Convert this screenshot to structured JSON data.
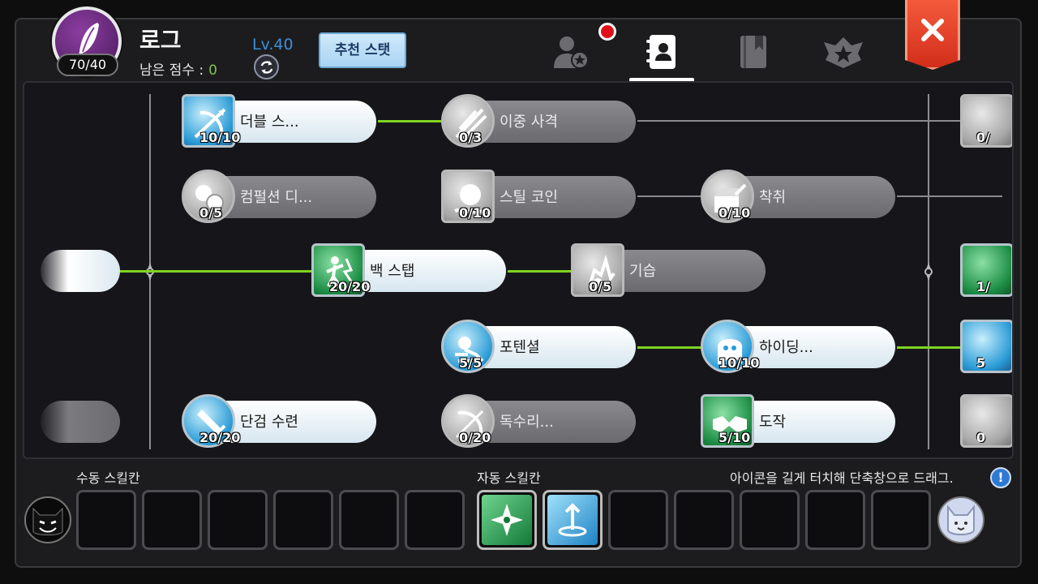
{
  "header": {
    "class_name": "로그",
    "ability_points": "70/40",
    "remaining_label": "남은 점수 :",
    "remaining_value": "0",
    "level": "Lv.40",
    "recommend_button": "추천 스탯",
    "tabs": [
      "character-tab",
      "skill-book-tab",
      "codex-tab",
      "rank-tab"
    ],
    "active_tab": "skill-book-tab",
    "accent_color": "#7ed321"
  },
  "tree": {
    "left_partials": [
      {
        "state": "learned"
      },
      {
        "state": "locked"
      }
    ],
    "skills": [
      {
        "id": "double-shot",
        "name": "더블 스...",
        "level": "10/10",
        "state": "learned",
        "shape": "square",
        "color": "blue"
      },
      {
        "id": "dual-shot",
        "name": "이중 사격",
        "level": "0/3",
        "state": "locked",
        "shape": "circle",
        "color": "grey"
      },
      {
        "id": "compulsion",
        "name": "컴펄션 디...",
        "level": "0/5",
        "state": "locked",
        "shape": "circle",
        "color": "grey"
      },
      {
        "id": "steal-coin",
        "name": "스틸 코인",
        "level": "0/10",
        "state": "locked",
        "shape": "square",
        "color": "grey"
      },
      {
        "id": "extortion",
        "name": "착취",
        "level": "0/10",
        "state": "locked",
        "shape": "circle",
        "color": "grey"
      },
      {
        "id": "back-step",
        "name": "백 스탭",
        "level": "20/20",
        "state": "learned",
        "shape": "square",
        "color": "green"
      },
      {
        "id": "ambush",
        "name": "기습",
        "level": "0/5",
        "state": "locked",
        "shape": "square",
        "color": "grey"
      },
      {
        "id": "potential",
        "name": "포텐셜",
        "level": "5/5",
        "state": "learned",
        "shape": "circle",
        "color": "blue"
      },
      {
        "id": "hiding",
        "name": "하이딩...",
        "level": "10/10",
        "state": "learned",
        "shape": "circle",
        "color": "blue"
      },
      {
        "id": "dagger-training",
        "name": "단검 수련",
        "level": "20/20",
        "state": "learned",
        "shape": "circle",
        "color": "blue"
      },
      {
        "id": "poison",
        "name": "독수리...",
        "level": "0/20",
        "state": "locked",
        "shape": "circle",
        "color": "grey"
      },
      {
        "id": "steal",
        "name": "도작",
        "level": "5/10",
        "state": "learned",
        "shape": "square",
        "color": "green"
      }
    ],
    "right_partials": [
      {
        "level": "0/",
        "color": "grey"
      },
      {
        "level": "1/",
        "color": "green"
      },
      {
        "level": "5",
        "color": "blue"
      },
      {
        "level": "0",
        "color": "grey"
      }
    ]
  },
  "bottom": {
    "manual_label": "수동 스킬칸",
    "auto_label": "자동 스킬칸",
    "hint": "아이콘을 길게 터치해 단축창으로 드래그.",
    "info_glyph": "!",
    "manual_slots": 6,
    "auto_slots": [
      {
        "filled": true,
        "color": "green"
      },
      {
        "filled": true,
        "color": "blue"
      },
      {
        "filled": false
      },
      {
        "filled": false
      },
      {
        "filled": false
      },
      {
        "filled": false
      },
      {
        "filled": false
      }
    ]
  }
}
